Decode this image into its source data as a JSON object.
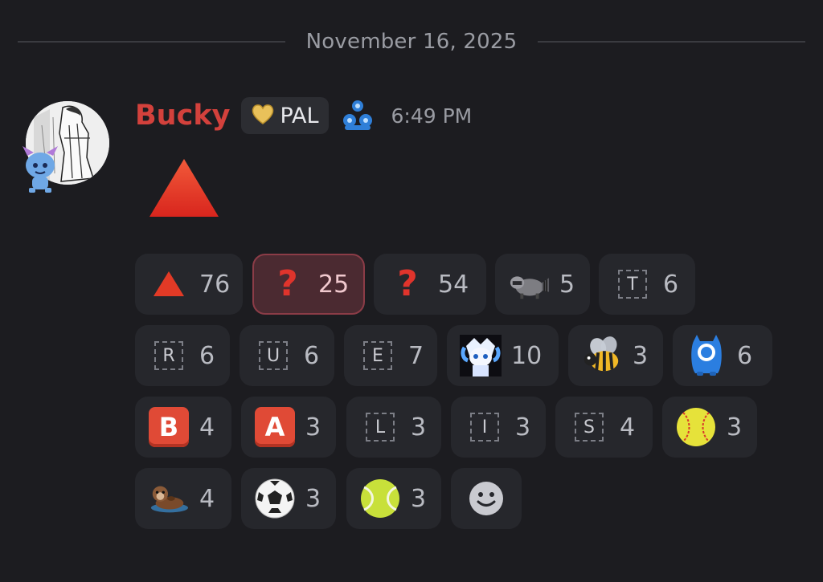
{
  "divider": {
    "date": "November 16, 2025"
  },
  "message": {
    "username": "Bucky",
    "tag": {
      "label": "PAL",
      "icon": "heart-badge-icon"
    },
    "time": "6:49 PM",
    "content_emoji": "red-triangle-up-icon"
  },
  "reactions": [
    {
      "icon": "red-triangle-up-icon",
      "count": "76",
      "active": false
    },
    {
      "icon": "red-question-mark-icon",
      "count": "25",
      "active": true
    },
    {
      "icon": "red-question-mark-icon",
      "count": "54",
      "active": false
    },
    {
      "icon": "raccoon-icon",
      "count": "5",
      "active": false
    },
    {
      "icon": "letter-t-icon",
      "letter": "T",
      "count": "6",
      "active": false
    },
    {
      "icon": "letter-r-icon",
      "letter": "R",
      "count": "6",
      "active": false
    },
    {
      "icon": "letter-u-icon",
      "letter": "U",
      "count": "6",
      "active": false
    },
    {
      "icon": "letter-e-icon",
      "letter": "E",
      "count": "7",
      "active": false
    },
    {
      "icon": "anime-character-icon",
      "count": "10",
      "active": false
    },
    {
      "icon": "bee-icon",
      "count": "3",
      "active": false
    },
    {
      "icon": "blue-monster-icon",
      "count": "6",
      "active": false
    },
    {
      "icon": "b-button-icon",
      "letter": "B",
      "count": "4",
      "active": false
    },
    {
      "icon": "a-button-icon",
      "letter": "A",
      "count": "3",
      "active": false
    },
    {
      "icon": "letter-l-icon",
      "letter": "L",
      "count": "3",
      "active": false
    },
    {
      "icon": "letter-i-icon",
      "letter": "I",
      "count": "3",
      "active": false
    },
    {
      "icon": "letter-s-icon",
      "letter": "S",
      "count": "4",
      "active": false
    },
    {
      "icon": "softball-icon",
      "count": "3",
      "active": false
    },
    {
      "icon": "otter-icon",
      "count": "4",
      "active": false
    },
    {
      "icon": "soccer-ball-icon",
      "count": "3",
      "active": false
    },
    {
      "icon": "tennis-ball-icon",
      "count": "3",
      "active": false
    }
  ],
  "add_reaction": {
    "icon": "add-reaction-smiley-icon"
  },
  "colors": {
    "background": "#1c1c20",
    "username": "#d3413c",
    "reaction_bg": "#26272c",
    "reaction_active_bg": "#4b2a31",
    "reaction_active_border": "#8b3c47"
  }
}
